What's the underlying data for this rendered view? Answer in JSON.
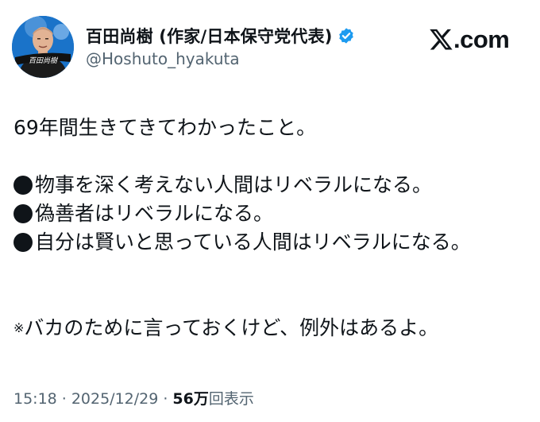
{
  "header": {
    "display_name": "百田尚樹 (作家/日本保守党代表)",
    "handle": "@Hoshuto_hyakuta",
    "avatar_caption": "百田尚樹",
    "verified_icon": "verified-badge-icon",
    "brand_text": ".com",
    "brand_icon": "x-logo-icon"
  },
  "tweet": {
    "intro": "69年間生きてきてわかったこと。",
    "bullets": [
      "物事を深く考えない人間はリベラルになる。",
      "偽善者はリベラルになる。",
      "自分は賢いと思っている人間はリベラルになる。"
    ],
    "note_mark": "※",
    "note_text": "バカのために言っておくけど、例外はあるよ。"
  },
  "meta": {
    "time": "15:18",
    "separator": "·",
    "date": "2025/12/29",
    "views_count": "56万",
    "views_label": "回表示"
  },
  "colors": {
    "text": "#0f1419",
    "secondary": "#536471",
    "verified": "#1d9bf0",
    "avatar_bg": "#1a73c9"
  }
}
